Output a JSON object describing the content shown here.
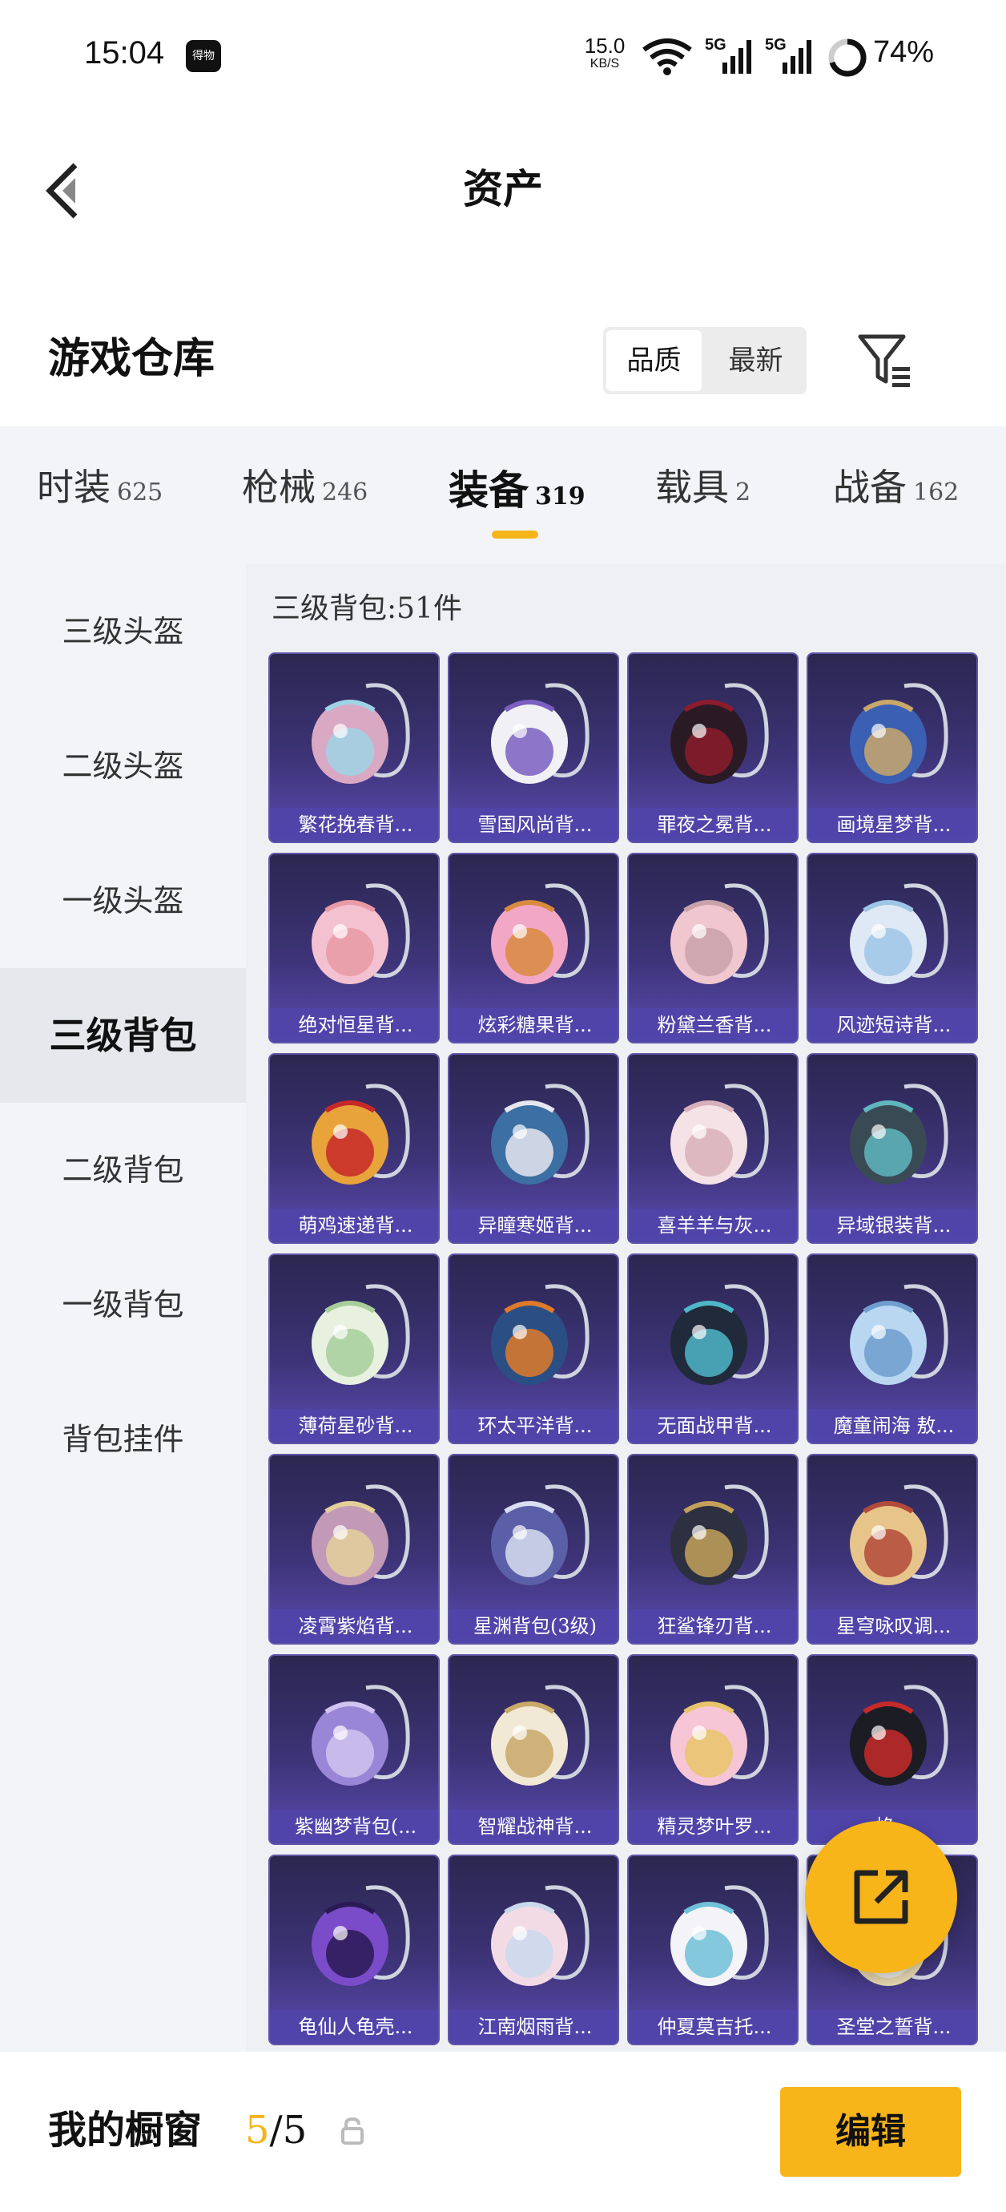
{
  "status_bar": {
    "time": "15:04",
    "app_badge": "得物",
    "net_speed_value": "15.0",
    "net_speed_unit": "KB/S",
    "signal_1": "5G",
    "signal_2": "5G",
    "battery": "74%"
  },
  "header": {
    "title": "资产"
  },
  "warehouse": {
    "title": "游戏仓库",
    "sort_options": [
      "品质",
      "最新"
    ],
    "active_sort": "品质"
  },
  "tabs": [
    {
      "label": "时装",
      "count": "625"
    },
    {
      "label": "枪械",
      "count": "246"
    },
    {
      "label": "装备",
      "count": "319"
    },
    {
      "label": "载具",
      "count": "2"
    },
    {
      "label": "战备",
      "count": "162"
    }
  ],
  "active_tab": "装备",
  "sidebar": {
    "items": [
      "三级头盔",
      "二级头盔",
      "一级头盔",
      "三级背包",
      "二级背包",
      "一级背包",
      "背包挂件"
    ],
    "active": "三级背包"
  },
  "content": {
    "heading": "三级背包:51件",
    "items": [
      {
        "name": "繁花挽春背...",
        "icon": "backpack-floral-icon"
      },
      {
        "name": "雪国风尚背...",
        "icon": "backpack-penguin-icon"
      },
      {
        "name": "罪夜之冕背...",
        "icon": "backpack-dark-skull-icon"
      },
      {
        "name": "画境星梦背...",
        "icon": "backpack-frame-icon"
      },
      {
        "name": "绝对恒星背...",
        "icon": "backpack-popcorn-icon"
      },
      {
        "name": "炫彩糖果背...",
        "icon": "backpack-donut-icon"
      },
      {
        "name": "粉黛兰香背...",
        "icon": "backpack-pink-round-icon"
      },
      {
        "name": "风迹短诗背...",
        "icon": "backpack-gift-box-icon"
      },
      {
        "name": "萌鸡速递背...",
        "icon": "backpack-chick-icon"
      },
      {
        "name": "异瞳寒姬背...",
        "icon": "backpack-rabbit-icon"
      },
      {
        "name": "喜羊羊与灰...",
        "icon": "backpack-sheep-icon"
      },
      {
        "name": "异域银装背...",
        "icon": "backpack-silver-icon"
      },
      {
        "name": "薄荷星砂背...",
        "icon": "backpack-mint-icon"
      },
      {
        "name": "环太平洋背...",
        "icon": "backpack-mech-icon"
      },
      {
        "name": "无面战甲背...",
        "icon": "backpack-armor-icon"
      },
      {
        "name": "魔童闹海 敖...",
        "icon": "backpack-ring-icon"
      },
      {
        "name": "凌霄紫焰背...",
        "icon": "backpack-lotus-icon"
      },
      {
        "name": "星渊背包(3级)",
        "icon": "backpack-star-abyss-icon"
      },
      {
        "name": "狂鲨锋刃背...",
        "icon": "backpack-shark-icon"
      },
      {
        "name": "星穹咏叹调...",
        "icon": "backpack-gold-icon"
      },
      {
        "name": "紫幽梦背包(...",
        "icon": "backpack-purple-flower-icon"
      },
      {
        "name": "智耀战神背...",
        "icon": "backpack-wings-icon"
      },
      {
        "name": "精灵梦叶罗...",
        "icon": "backpack-heart-icon"
      },
      {
        "name": "焰...",
        "icon": "backpack-red-icon"
      },
      {
        "name": "龟仙人龟壳...",
        "icon": "backpack-turtle-shell-icon"
      },
      {
        "name": "江南烟雨背...",
        "icon": "backpack-rose-icon"
      },
      {
        "name": "仲夏莫吉托...",
        "icon": "backpack-white-icon"
      },
      {
        "name": "圣堂之誓背...",
        "icon": "backpack-holy-icon"
      }
    ]
  },
  "bottom_bar": {
    "label": "我的橱窗",
    "count_current": "5",
    "count_total": "/5",
    "edit_label": "编辑"
  },
  "colors": {
    "accent": "#f5b41a",
    "card_bg": "#3d3377",
    "label_bg": "#5044aa",
    "panel_bg": "#f2f4f8"
  }
}
